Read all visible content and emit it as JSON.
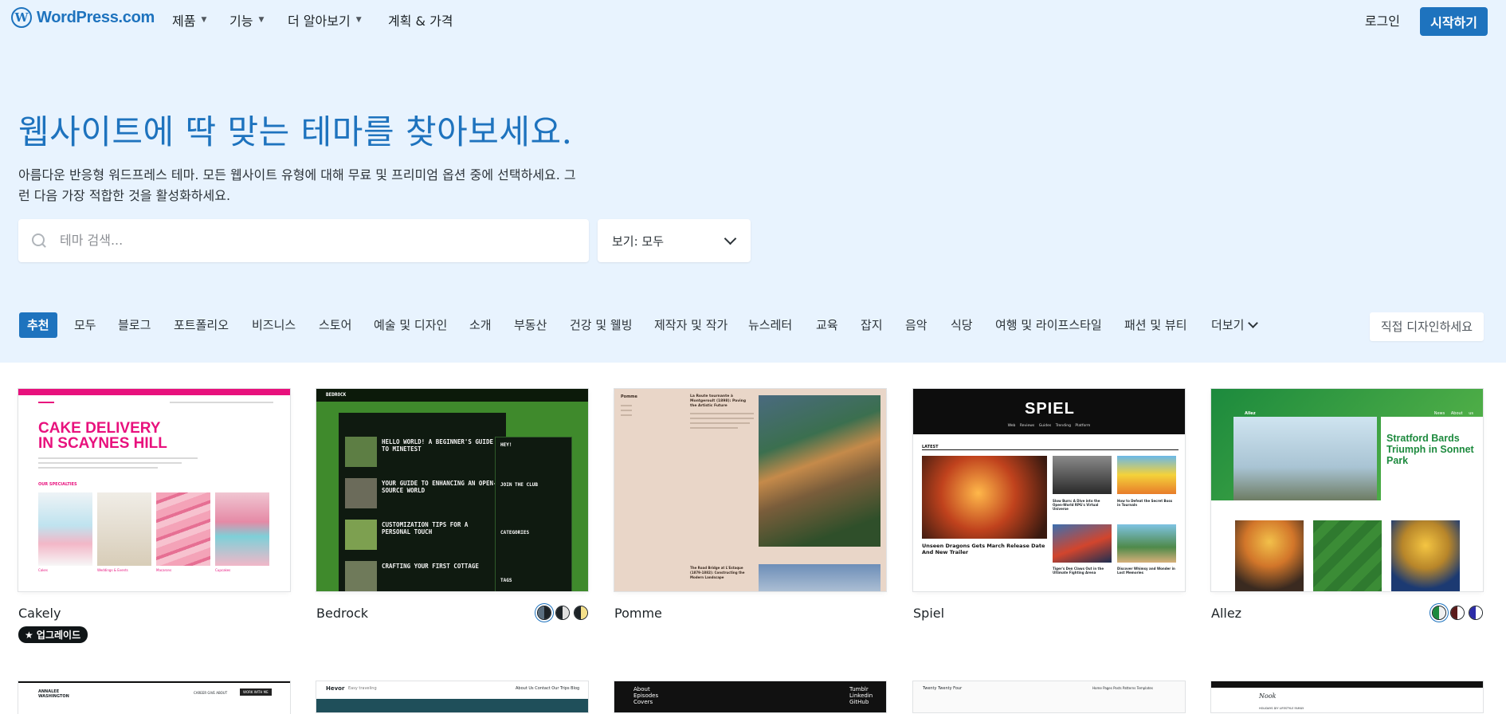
{
  "nav": {
    "logo_mark": "W",
    "logo_text": "WordPress.com",
    "items": [
      {
        "label": "제품",
        "has_menu": true
      },
      {
        "label": "기능",
        "has_menu": true
      },
      {
        "label": "더 알아보기",
        "has_menu": true
      },
      {
        "label": "계획 & 가격",
        "has_menu": false
      }
    ],
    "caret": "▼",
    "login": "로그인",
    "start": "시작하기"
  },
  "hero": {
    "title": "웹사이트에 딱 맞는 테마를 찾아보세요.",
    "description": "아름다운 반응형 워드프레스 테마. 모든 웹사이트 유형에 대해 무료 및 프리미엄 옵션 중에 선택하세요. 그런 다음 가장 적합한 것을 활성화하세요.",
    "search_placeholder": "테마 검색...",
    "view_select": "보기: 모두"
  },
  "categories": {
    "items": [
      "추천",
      "모두",
      "블로그",
      "포트폴리오",
      "비즈니스",
      "스토어",
      "예술 및 디자인",
      "소개",
      "부동산",
      "건강 및 웰빙",
      "제작자 및 작가",
      "뉴스레터",
      "교육",
      "잡지",
      "음악",
      "식당",
      "여행 및 라이프스타일",
      "패션 및 뷰티"
    ],
    "active": "추천",
    "more": "더보기",
    "design_button": "직접 디자인하세요"
  },
  "themes": [
    {
      "name": "Cakely",
      "badge": "★ 업그레이드",
      "preview": {
        "title_line1": "CAKE DELIVERY",
        "title_line2": "IN SCAYNES HILL",
        "section": "OUR SPECIALTIES",
        "items": [
          "Cakes",
          "Weddings & Events",
          "Macarons",
          "Cupcakes"
        ]
      }
    },
    {
      "name": "Bedrock",
      "swatches": [
        [
          "#5a6e7f",
          "#1d2327"
        ],
        [
          "#1d2327",
          "#e0e0e0"
        ],
        [
          "#1d2327",
          "#f5e08a"
        ]
      ],
      "preview": {
        "brand": "BEDROCK",
        "posts": [
          "HELLO WORLD! A BEGINNER'S GUIDE TO MINETEST",
          "YOUR GUIDE TO ENHANCING AN OPEN-SOURCE WORLD",
          "CUSTOMIZATION TIPS FOR A PERSONAL TOUCH",
          "CRAFTING YOUR FIRST COTTAGE"
        ],
        "sidebar": [
          "HEY!",
          "JOIN THE CLUB",
          "CATEGORIES",
          "TAGS"
        ]
      }
    },
    {
      "name": "Pomme",
      "preview": {
        "brand": "Pomme",
        "headline": "La Route tournante à Montgeroult (1898): Paving the Artistic Future",
        "headline2": "The Road Bridge at L'Estaque (1879-1882): Constructing the Modern Landscape"
      }
    },
    {
      "name": "Spiel",
      "preview": {
        "logo": "SPIEL",
        "menu": [
          "Web",
          "Reviews",
          "Guides",
          "Trending",
          "Platform"
        ],
        "section": "LATEST",
        "headline": "Unseen Dragons Gets March Release Date And New Trailer",
        "cards": [
          "Slow Burn: A Dive into the Open-World RPG's Virtual Universe",
          "How to Defeat the Secret Boss in Tournaln",
          "Tiger's Den Claws Out in the Ultimate Fighting Arena",
          "Discover Whimsy and Wonder in Lost Memories"
        ]
      }
    },
    {
      "name": "Allez",
      "swatches": [
        [
          "#1d8a3e",
          "#f0f0f0"
        ],
        [
          "#5a1a1a",
          "#ffffff"
        ],
        [
          "#2c2ca8",
          "#ffffff"
        ]
      ],
      "preview": {
        "brand": "Allez",
        "nav": [
          "News",
          "About us"
        ],
        "headline": "Stratford Bards Triumph in Sonnet Park"
      }
    }
  ],
  "row2": [
    {
      "text": "ANNALEE WASHINGTON",
      "menu": "CAREER  GIVE  ABOUT",
      "cta": "WORK WITH ME"
    },
    {
      "text": "Hevor",
      "menu": "About Us  Contact  Our Trips  Blog",
      "tag": "Easy traveling"
    },
    {
      "text": "About Episodes Covers",
      "menu": "Tumblr Linkedin GitHub"
    },
    {
      "text": "Twenty Twenty Four",
      "menu": "Home  Pages  Posts  Patterns  Templates"
    },
    {
      "text": "Nook",
      "menu": "HOLIDAYS  DIY  LIFESTYLE  FAMILY"
    }
  ],
  "colors": {
    "brand": "#1e73be",
    "hero_bg": "#e8f3fe",
    "cakely_pink": "#e8117d"
  }
}
